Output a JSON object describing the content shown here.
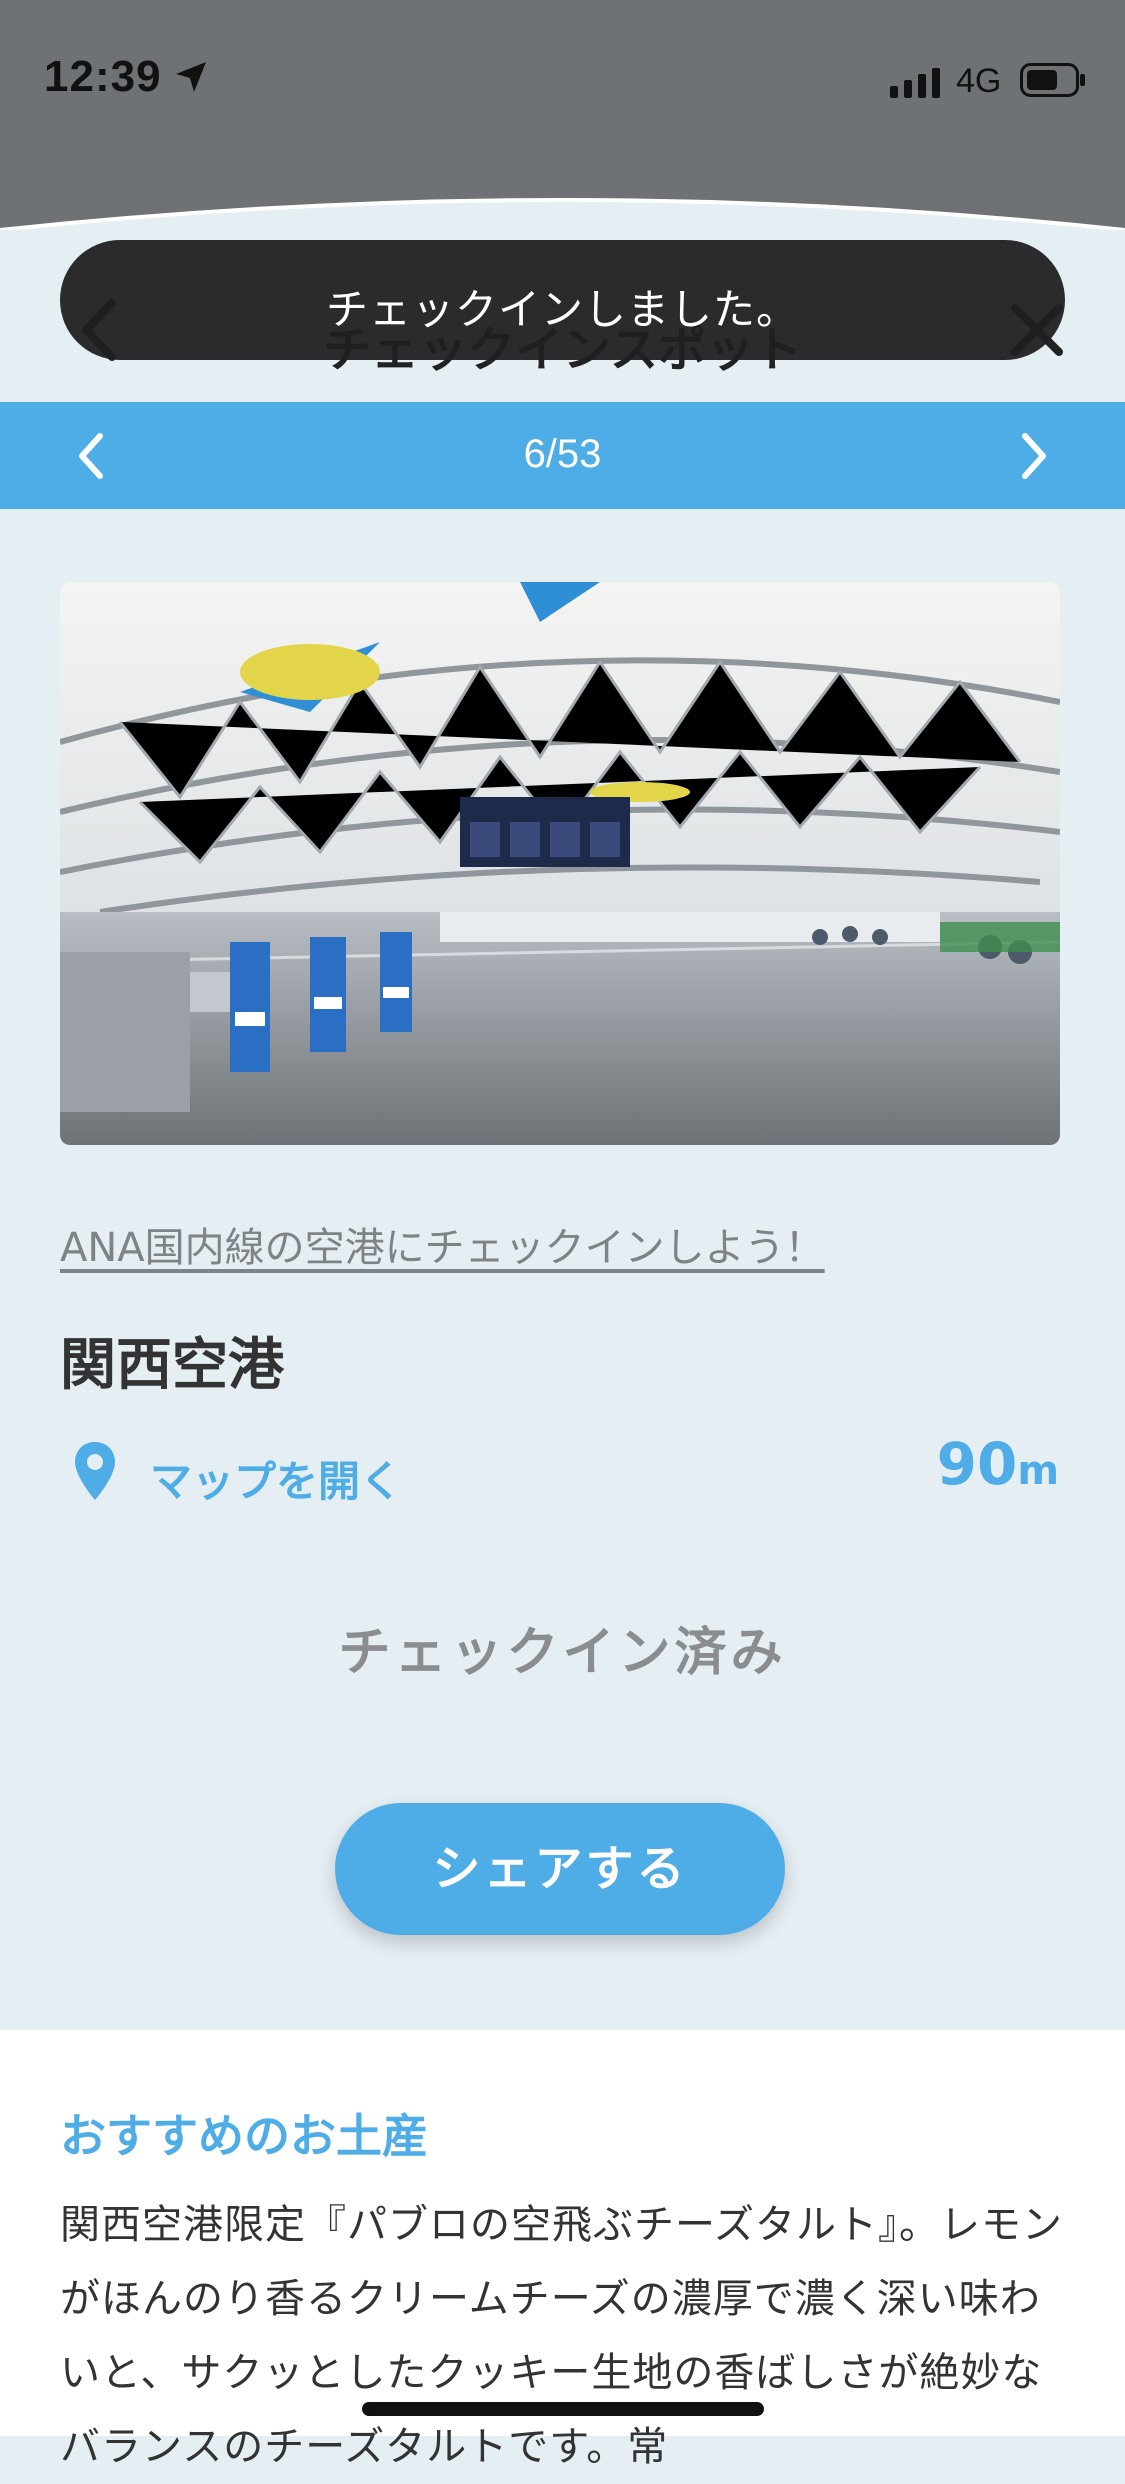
{
  "status_bar": {
    "time": "12:39",
    "network": "4G"
  },
  "header": {
    "title": "チェックインスポット"
  },
  "toast": {
    "message": "チェックインしました。"
  },
  "pager": {
    "current": "6/53"
  },
  "spot": {
    "campaign_link": "ANA国内線の空港にチェックインしよう！",
    "name": "関西空港",
    "map_link": "マップを開く",
    "distance_value": "90",
    "distance_unit": "m",
    "status": "チェックイン済み",
    "share_label": "シェアする"
  },
  "souvenir": {
    "title": "おすすめのお土産",
    "body": "関西空港限定『パブロの空飛ぶチーズタルト』。レモンがほんのり香るクリームチーズの濃厚で濃く深い味わいと、サクッとしたクッキー生地の香ばしさが絶妙なバランスのチーズタルトです。常"
  },
  "colors": {
    "accent": "#4eace6",
    "background": "#e5eef3",
    "toast": "#1f1f21"
  }
}
